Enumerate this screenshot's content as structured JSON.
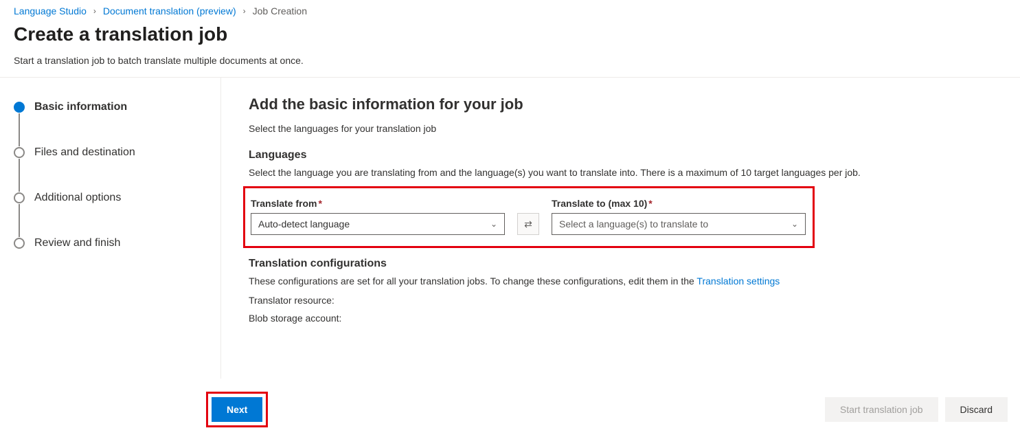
{
  "breadcrumb": {
    "items": [
      {
        "label": "Language Studio",
        "link": true
      },
      {
        "label": "Document translation (preview)",
        "link": true
      },
      {
        "label": "Job Creation",
        "link": false
      }
    ]
  },
  "header": {
    "title": "Create a translation job",
    "subtitle": "Start a translation job to batch translate multiple documents at once."
  },
  "steps": [
    {
      "label": "Basic information",
      "active": true
    },
    {
      "label": "Files and destination",
      "active": false
    },
    {
      "label": "Additional options",
      "active": false
    },
    {
      "label": "Review and finish",
      "active": false
    }
  ],
  "main": {
    "heading": "Add the basic information for your job",
    "desc": "Select the languages for your translation job",
    "languages": {
      "title": "Languages",
      "sub": "Select the language you are translating from and the language(s) you want to translate into. There is a maximum of 10 target languages per job.",
      "from_label": "Translate from",
      "from_value": "Auto-detect language",
      "to_label": "Translate to (max 10)",
      "to_placeholder": "Select a language(s) to translate to"
    },
    "config": {
      "title": "Translation configurations",
      "desc_pre": "These configurations are set for all your translation jobs. To change these configurations, edit them in the ",
      "link": "Translation settings",
      "resource_label": "Translator resource:",
      "blob_label": "Blob storage account:"
    }
  },
  "footer": {
    "next": "Next",
    "start": "Start translation job",
    "discard": "Discard"
  }
}
